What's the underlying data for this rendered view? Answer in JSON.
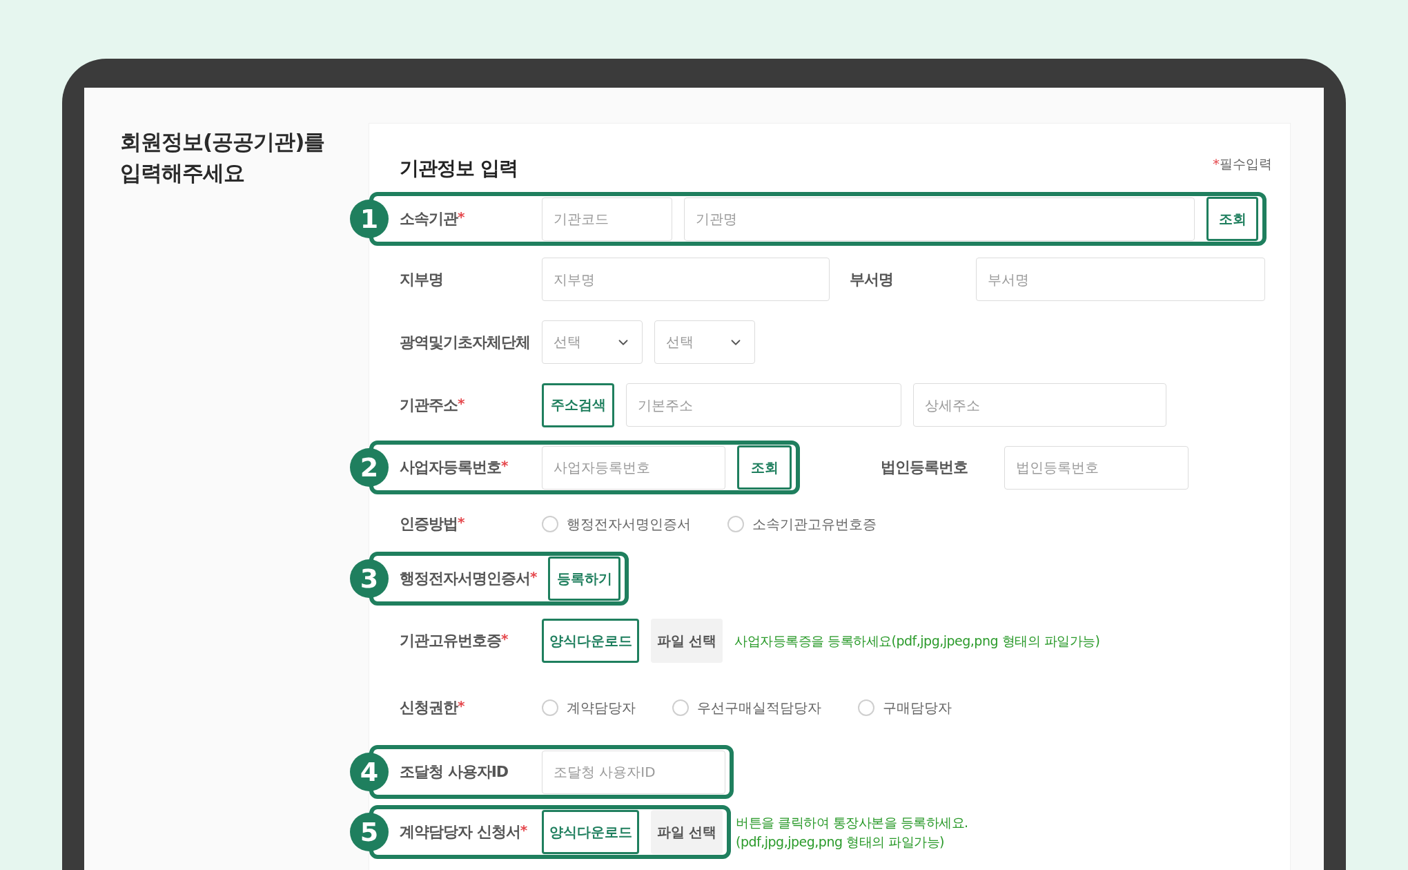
{
  "page_title": "회원정보(공공기관)를\n입력해주세요",
  "form": {
    "title": "기관정보 입력",
    "required_note": {
      "mark": "*",
      "text": "필수입력"
    },
    "rows": [
      {
        "label": "소속기관",
        "required_mark": "*",
        "step": "1",
        "items": [
          {
            "kind": "input",
            "placeholder": "기관코드"
          },
          {
            "kind": "input",
            "placeholder": "기관명"
          },
          {
            "kind": "button",
            "text": "조회"
          }
        ]
      },
      {
        "label": "지부명",
        "items": [
          {
            "kind": "input",
            "placeholder": "지부명"
          },
          {
            "kind": "label",
            "text": "부서명"
          },
          {
            "kind": "input",
            "placeholder": "부서명"
          }
        ]
      },
      {
        "label": "광역및기초자체단체",
        "items": [
          {
            "kind": "select",
            "placeholder": "선택"
          },
          {
            "kind": "select",
            "placeholder": "선택"
          }
        ]
      },
      {
        "label": "기관주소",
        "required_mark": "*",
        "items": [
          {
            "kind": "button",
            "text": "주소검색"
          },
          {
            "kind": "input",
            "placeholder": "기본주소"
          },
          {
            "kind": "input",
            "placeholder": "상세주소"
          }
        ]
      },
      {
        "label": "사업자등록번호",
        "required_mark": "*",
        "step": "2",
        "items": [
          {
            "kind": "input",
            "placeholder": "사업자등록번호"
          },
          {
            "kind": "button",
            "text": "조회"
          }
        ],
        "side_items": [
          {
            "kind": "label",
            "text": "법인등록번호"
          },
          {
            "kind": "input",
            "placeholder": "법인등록번호"
          }
        ]
      },
      {
        "label": "인증방법",
        "required_mark": "*",
        "items": [
          {
            "kind": "radio",
            "label": "행정전자서명인증서",
            "selected": false
          },
          {
            "kind": "radio",
            "label": "소속기관고유번호증",
            "selected": false
          }
        ]
      },
      {
        "label": "행정전자서명인증서",
        "required_mark": "*",
        "step": "3",
        "items": [
          {
            "kind": "button",
            "text": "등록하기"
          }
        ]
      },
      {
        "label": "기관고유번호증",
        "required_mark": "*",
        "items": [
          {
            "kind": "button",
            "text": "양식다운로드"
          },
          {
            "kind": "file_button",
            "text": "파일 선택"
          },
          {
            "kind": "note",
            "text": "사업자등록증을 등록하세요(pdf,jpg,jpeg,png 형태의 파일가능)"
          }
        ]
      },
      {
        "label": "신청권한",
        "required_mark": "*",
        "items": [
          {
            "kind": "radio",
            "label": "계약담당자",
            "selected": false
          },
          {
            "kind": "radio",
            "label": "우선구매실적담당자",
            "selected": false
          },
          {
            "kind": "radio",
            "label": "구매담당자",
            "selected": false
          }
        ]
      },
      {
        "label": "조달청 사용자ID",
        "step": "4",
        "items": [
          {
            "kind": "input",
            "placeholder": "조달청 사용자ID"
          }
        ]
      },
      {
        "label": "계약담당자 신청서",
        "required_mark": "*",
        "step": "5",
        "items": [
          {
            "kind": "button",
            "text": "양식다운로드"
          },
          {
            "kind": "file_button",
            "text": "파일 선택"
          }
        ],
        "side_items": [
          {
            "kind": "note",
            "text": "버튼을 클릭하여 통장사본을 등록하세요.\n(pdf,jpg,jpeg,png 형태의 파일가능)"
          }
        ]
      }
    ]
  }
}
